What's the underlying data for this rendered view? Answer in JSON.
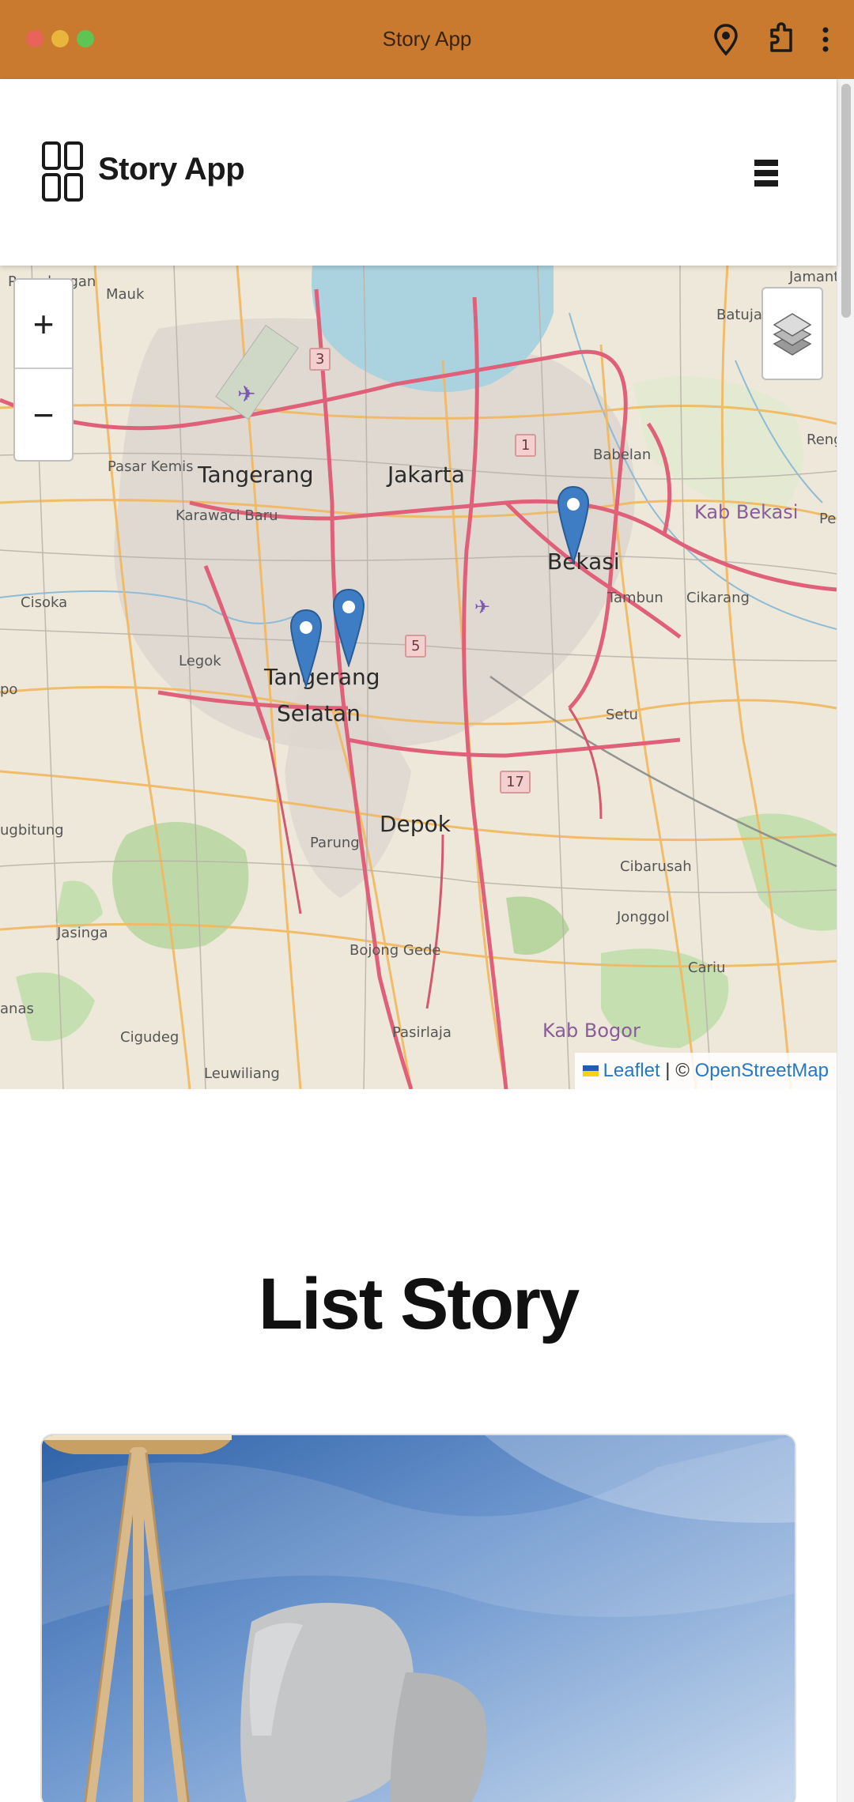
{
  "window": {
    "title": "Story App",
    "colors": {
      "titlebar": "#c97a2e"
    },
    "toolbar_icons": [
      "location-pin-icon",
      "extension-icon",
      "more-vert-icon"
    ]
  },
  "header": {
    "brand": "Story App",
    "logo_icon": "grid-logo-icon",
    "menu_icon": "hamburger-icon"
  },
  "map": {
    "zoom_in_label": "+",
    "zoom_out_label": "−",
    "layers_icon": "layers-icon",
    "attribution": {
      "leaflet": "Leaflet",
      "separator": " | © ",
      "osm": "OpenStreetMap"
    },
    "places": {
      "pagedangan": "Pagedangan",
      "mauk": "Mauk",
      "jamantri": "Jamantr",
      "batujaya": "Batujaya",
      "pasar_kemis": "Pasar Kemis",
      "tangerang": "Tangerang",
      "jakarta": "Jakarta",
      "babelan": "Babelan",
      "reng": "Reng",
      "karawaci": "Karawaci Baru",
      "kab_bekasi": "Kab Bekasi",
      "pe": "Pe",
      "bekasi": "Bekasi",
      "cisoka": "Cisoka",
      "tambun": "Tambun",
      "cikarang": "Cikarang",
      "legok": "Legok",
      "tangerang_selatan_1": "Tangerang",
      "tangerang_selatan_2": "Selatan",
      "setu": "Setu",
      "po": "po",
      "depok": "Depok",
      "parung": "Parung",
      "ugbitung": "ugbitung",
      "cibarusah": "Cibarusah",
      "jonggol": "Jonggol",
      "jasinga": "Jasinga",
      "bojong_gede": "Bojong Gede",
      "cariu": "Cariu",
      "anas": "anas",
      "pasirlaja": "Pasirlaja",
      "kab_bogor": "Kab Bogor",
      "cigudeg": "Cigudeg",
      "leuwiliang": "Leuwiliang"
    },
    "shields": [
      "3",
      "1",
      "5",
      "17"
    ],
    "marker_count": 3
  },
  "list": {
    "title": "List Story"
  }
}
